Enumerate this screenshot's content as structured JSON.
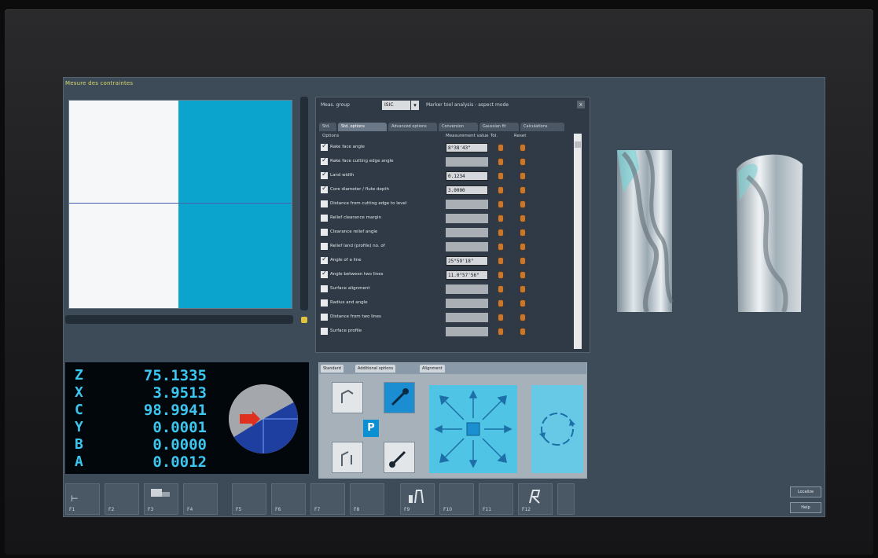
{
  "window": {
    "title": "Mesure des contraintes"
  },
  "param_panel": {
    "top_label": "Meas. group",
    "dropdown_value": "ISIC",
    "title": "Marker tool analysis - aspect mode",
    "close": "x",
    "tabs": [
      "Std.",
      "Std. options",
      "Advanced options",
      "Conversion",
      "Gaussian fit",
      "Calculations"
    ],
    "col_headers": {
      "options": "Options",
      "value": "Measurement value",
      "tol": "Tol.",
      "ref": "Reset"
    },
    "rows": [
      {
        "label": "Rake face angle",
        "checked": true,
        "value": "8°38'43\""
      },
      {
        "label": "Rake face cutting edge angle",
        "checked": true,
        "value": ""
      },
      {
        "label": "Land width",
        "checked": true,
        "value": "0.1234"
      },
      {
        "label": "Core diameter / flute depth",
        "checked": true,
        "value": "3.0000"
      },
      {
        "label": "Distance from cutting edge to level",
        "checked": false,
        "value": ""
      },
      {
        "label": "Relief clearance margin",
        "checked": false,
        "value": ""
      },
      {
        "label": "Clearance relief angle",
        "checked": false,
        "value": ""
      },
      {
        "label": "Relief land (profile) no. of",
        "checked": false,
        "value": ""
      },
      {
        "label": "Angle of a line",
        "checked": true,
        "value": "25°59'18\""
      },
      {
        "label": "Angle between two lines",
        "checked": true,
        "value": "11.0°57'56\""
      },
      {
        "label": "Surface alignment",
        "checked": false,
        "value": ""
      },
      {
        "label": "Radius and angle",
        "checked": false,
        "value": ""
      },
      {
        "label": "Distance from two lines",
        "checked": false,
        "value": ""
      },
      {
        "label": "Surface profile",
        "checked": false,
        "value": ""
      }
    ]
  },
  "dro": {
    "rows": [
      {
        "axis": "Z",
        "value": "75.1335"
      },
      {
        "axis": "X",
        "value": "3.9513"
      },
      {
        "axis": "C",
        "value": "98.9941"
      },
      {
        "axis": "Y",
        "value": "0.0001"
      },
      {
        "axis": "B",
        "value": "0.0000"
      },
      {
        "axis": "A",
        "value": "0.0012"
      }
    ]
  },
  "jog": {
    "tabs": [
      "Standard",
      "Additional options",
      "Alignment"
    ],
    "p_label": "P"
  },
  "fkeys": [
    "F1",
    "F2",
    "F3",
    "F4",
    "F5",
    "F6",
    "F7",
    "F8",
    "F9",
    "F10",
    "F11",
    "F12"
  ],
  "side_buttons": {
    "top": "Localize",
    "bottom": "Help"
  },
  "colors": {
    "accent": "#0aa4cc",
    "panel": "#3d4a57",
    "dro_text": "#3cc7f0"
  }
}
